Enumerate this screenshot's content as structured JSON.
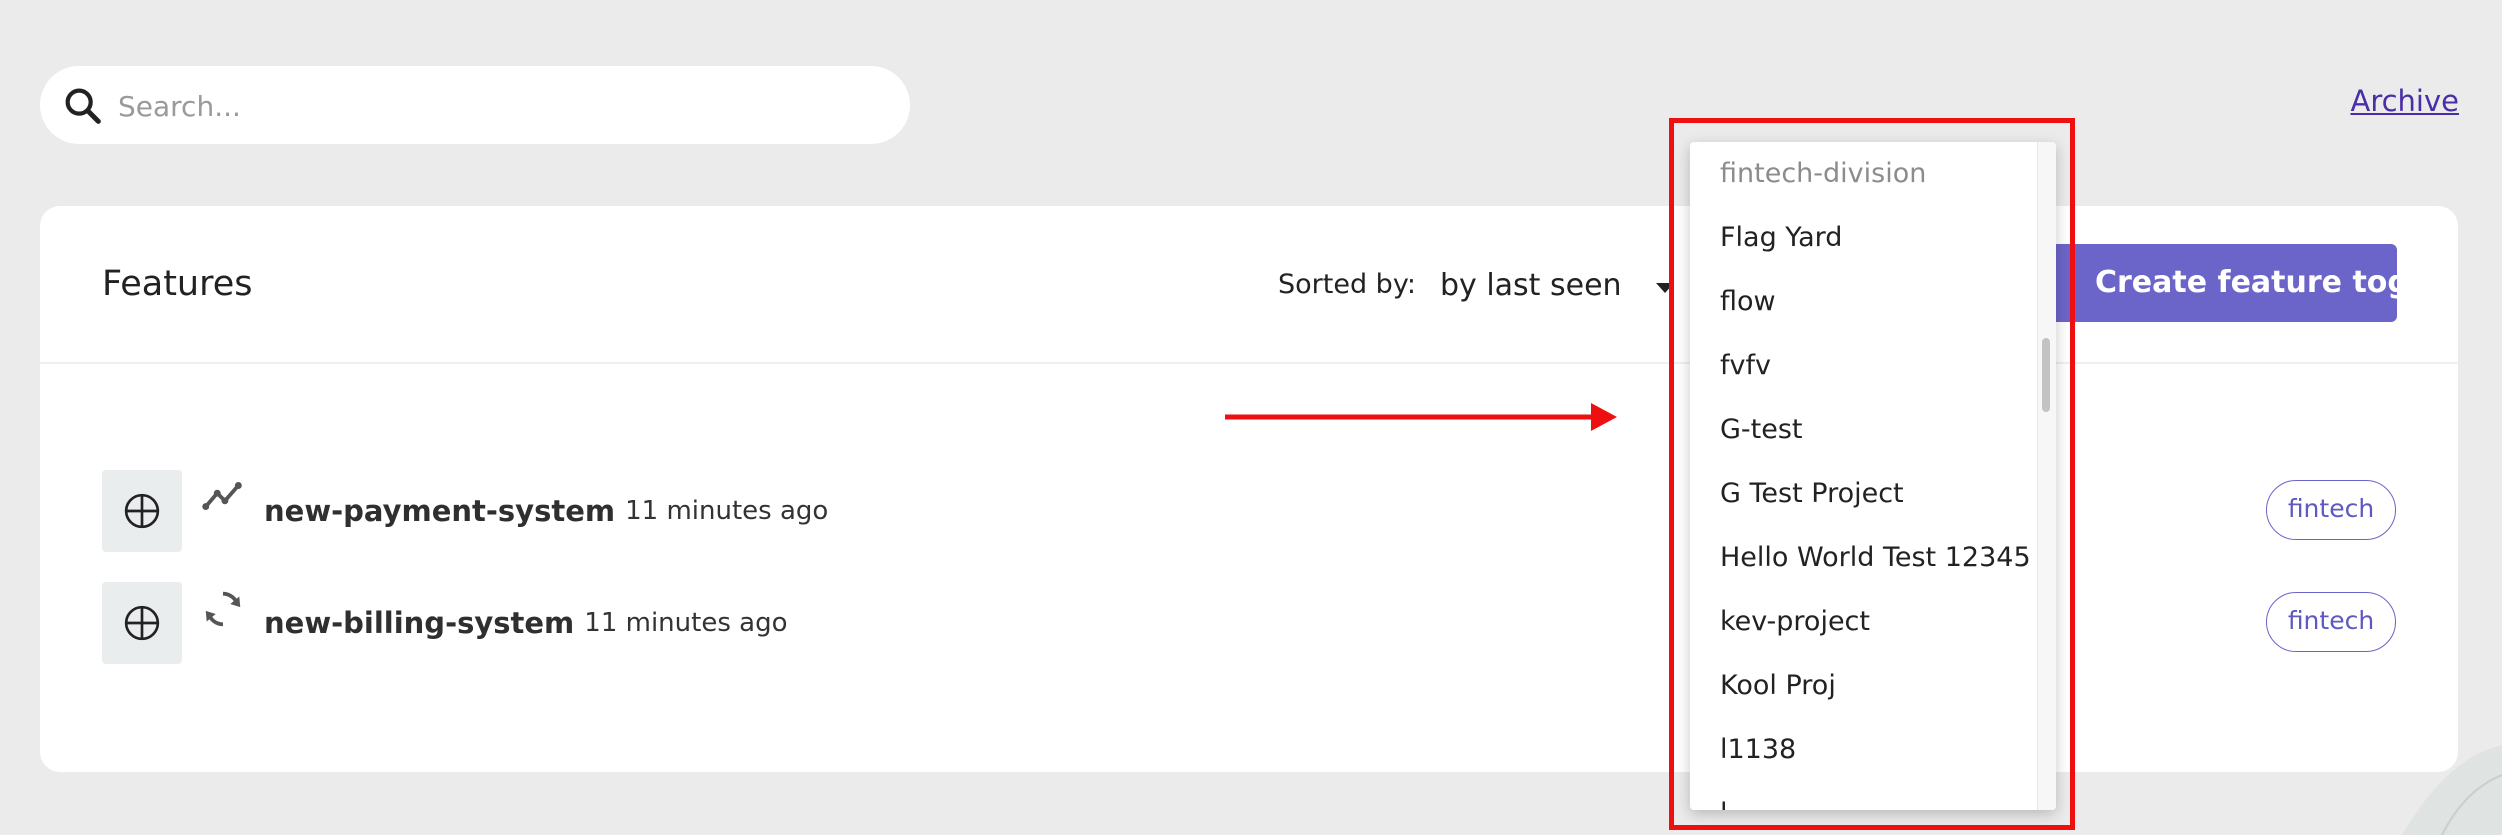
{
  "search": {
    "placeholder": "Search..."
  },
  "header_links": {
    "archive": "Archive"
  },
  "features_card": {
    "title": "Features",
    "sorted_by_label": "Sorted by:",
    "sort_value": "by last seen",
    "create_button": "Create feature toggle"
  },
  "features": [
    {
      "name": "new-payment-system",
      "time": "11 minutes ago",
      "status_icon": "trend-icon",
      "tag": "fintech"
    },
    {
      "name": "new-billing-system",
      "time": "11 minutes ago",
      "status_icon": "sync-icon",
      "tag": "fintech"
    }
  ],
  "project_dropdown": {
    "items": [
      {
        "label": "fintech-division"
      },
      {
        "label": "Flag Yard"
      },
      {
        "label": "flow"
      },
      {
        "label": "fvfv"
      },
      {
        "label": "G-test"
      },
      {
        "label": "G Test Project"
      },
      {
        "label": "Hello World Test 12345"
      },
      {
        "label": "kev-project"
      },
      {
        "label": "Kool Proj"
      },
      {
        "label": "l1138"
      },
      {
        "label": "l..."
      }
    ]
  },
  "colors": {
    "accent": "#6c65c9",
    "annotation": "#ee1010",
    "page_background": "#ebebeb"
  }
}
